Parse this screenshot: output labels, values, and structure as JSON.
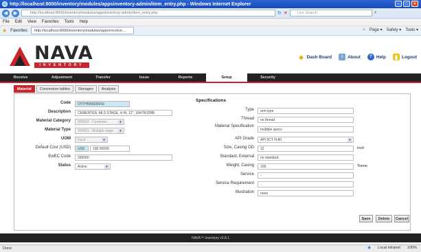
{
  "window": {
    "title": "http://localhost:8000/inventory/modules/appsinventory-admin/item_entry.php - Windows Internet Explorer"
  },
  "address": {
    "url": "http://localhost:8000/inventory/modules/appsinventory-admin/item_entry.php",
    "search_placeholder": "Live Search"
  },
  "menu": [
    "File",
    "Edit",
    "View",
    "Favorites",
    "Tools",
    "Help"
  ],
  "favorites": {
    "label": "Favorites",
    "tab_title": "http://localhost:8000/inventory/modules/apps/receive...",
    "tools": [
      "Page ▾",
      "Safety ▾",
      "Tools ▾"
    ]
  },
  "header": {
    "logo_text": "NAVA",
    "logo_sub": "INVENTORY",
    "links": [
      {
        "label": "Dash Board",
        "icon": "dashboard-icon"
      },
      {
        "label": "About",
        "icon": "about-icon"
      },
      {
        "label": "Help",
        "icon": "help-icon"
      },
      {
        "label": "Logout",
        "icon": "logout-icon"
      }
    ]
  },
  "nav": [
    "Receive",
    "Adjustment",
    "Transfer",
    "Issue",
    "Reports",
    "Setup",
    "Security"
  ],
  "subtabs": [
    "Material",
    "Conversion tables",
    "Storages",
    "Analysis"
  ],
  "form": {
    "code": {
      "label": "Code",
      "value": "OYTH50000001b"
    },
    "description": {
      "label": "Description",
      "value": "CEMENTER, MLS STAGE, 4-IN, 12\", 18#/TK/DBB"
    },
    "material_category": {
      "label": "Material Category",
      "value": "900012 - Cementer"
    },
    "material_type": {
      "label": "Material Type",
      "value": "200001 - Multiple stage"
    },
    "uom": {
      "label": "UOM",
      "value": "Each"
    },
    "default_cost": {
      "label": "Default Cost (USD)",
      "currency": "USD",
      "value": "100.00000"
    },
    "ewec_code": {
      "label": "EwEC Code",
      "value": "330000"
    },
    "status": {
      "label": "Status",
      "value": "Active"
    }
  },
  "specs": {
    "title": "Specifications",
    "fields": [
      {
        "label": "Type",
        "value": "arm type"
      },
      {
        "label": "Thread",
        "value": "no thread"
      },
      {
        "label": "Material Specification",
        "value": "multiple specs"
      },
      {
        "label": "API Grade",
        "value": "API 5CT N-80",
        "select": true
      },
      {
        "label": "Size, Casing OD",
        "value": "12",
        "unit": "Inch"
      },
      {
        "label": "Standard, External",
        "value": "no standard"
      },
      {
        "label": "Weight, Casing",
        "value": "100",
        "unit": "Tonne"
      },
      {
        "label": "Service",
        "value": "-"
      },
      {
        "label": "Service Requirement",
        "value": "-"
      },
      {
        "label": "Illustration",
        "value": "none"
      }
    ]
  },
  "buttons": {
    "save": "Save",
    "delete": "Delete",
    "cancel": "Cancel"
  },
  "footer": {
    "text": "NAVA™ Inventory v3.8.1"
  },
  "status": {
    "left": "Done",
    "zone": "Local intranet",
    "zoom": "100%"
  }
}
